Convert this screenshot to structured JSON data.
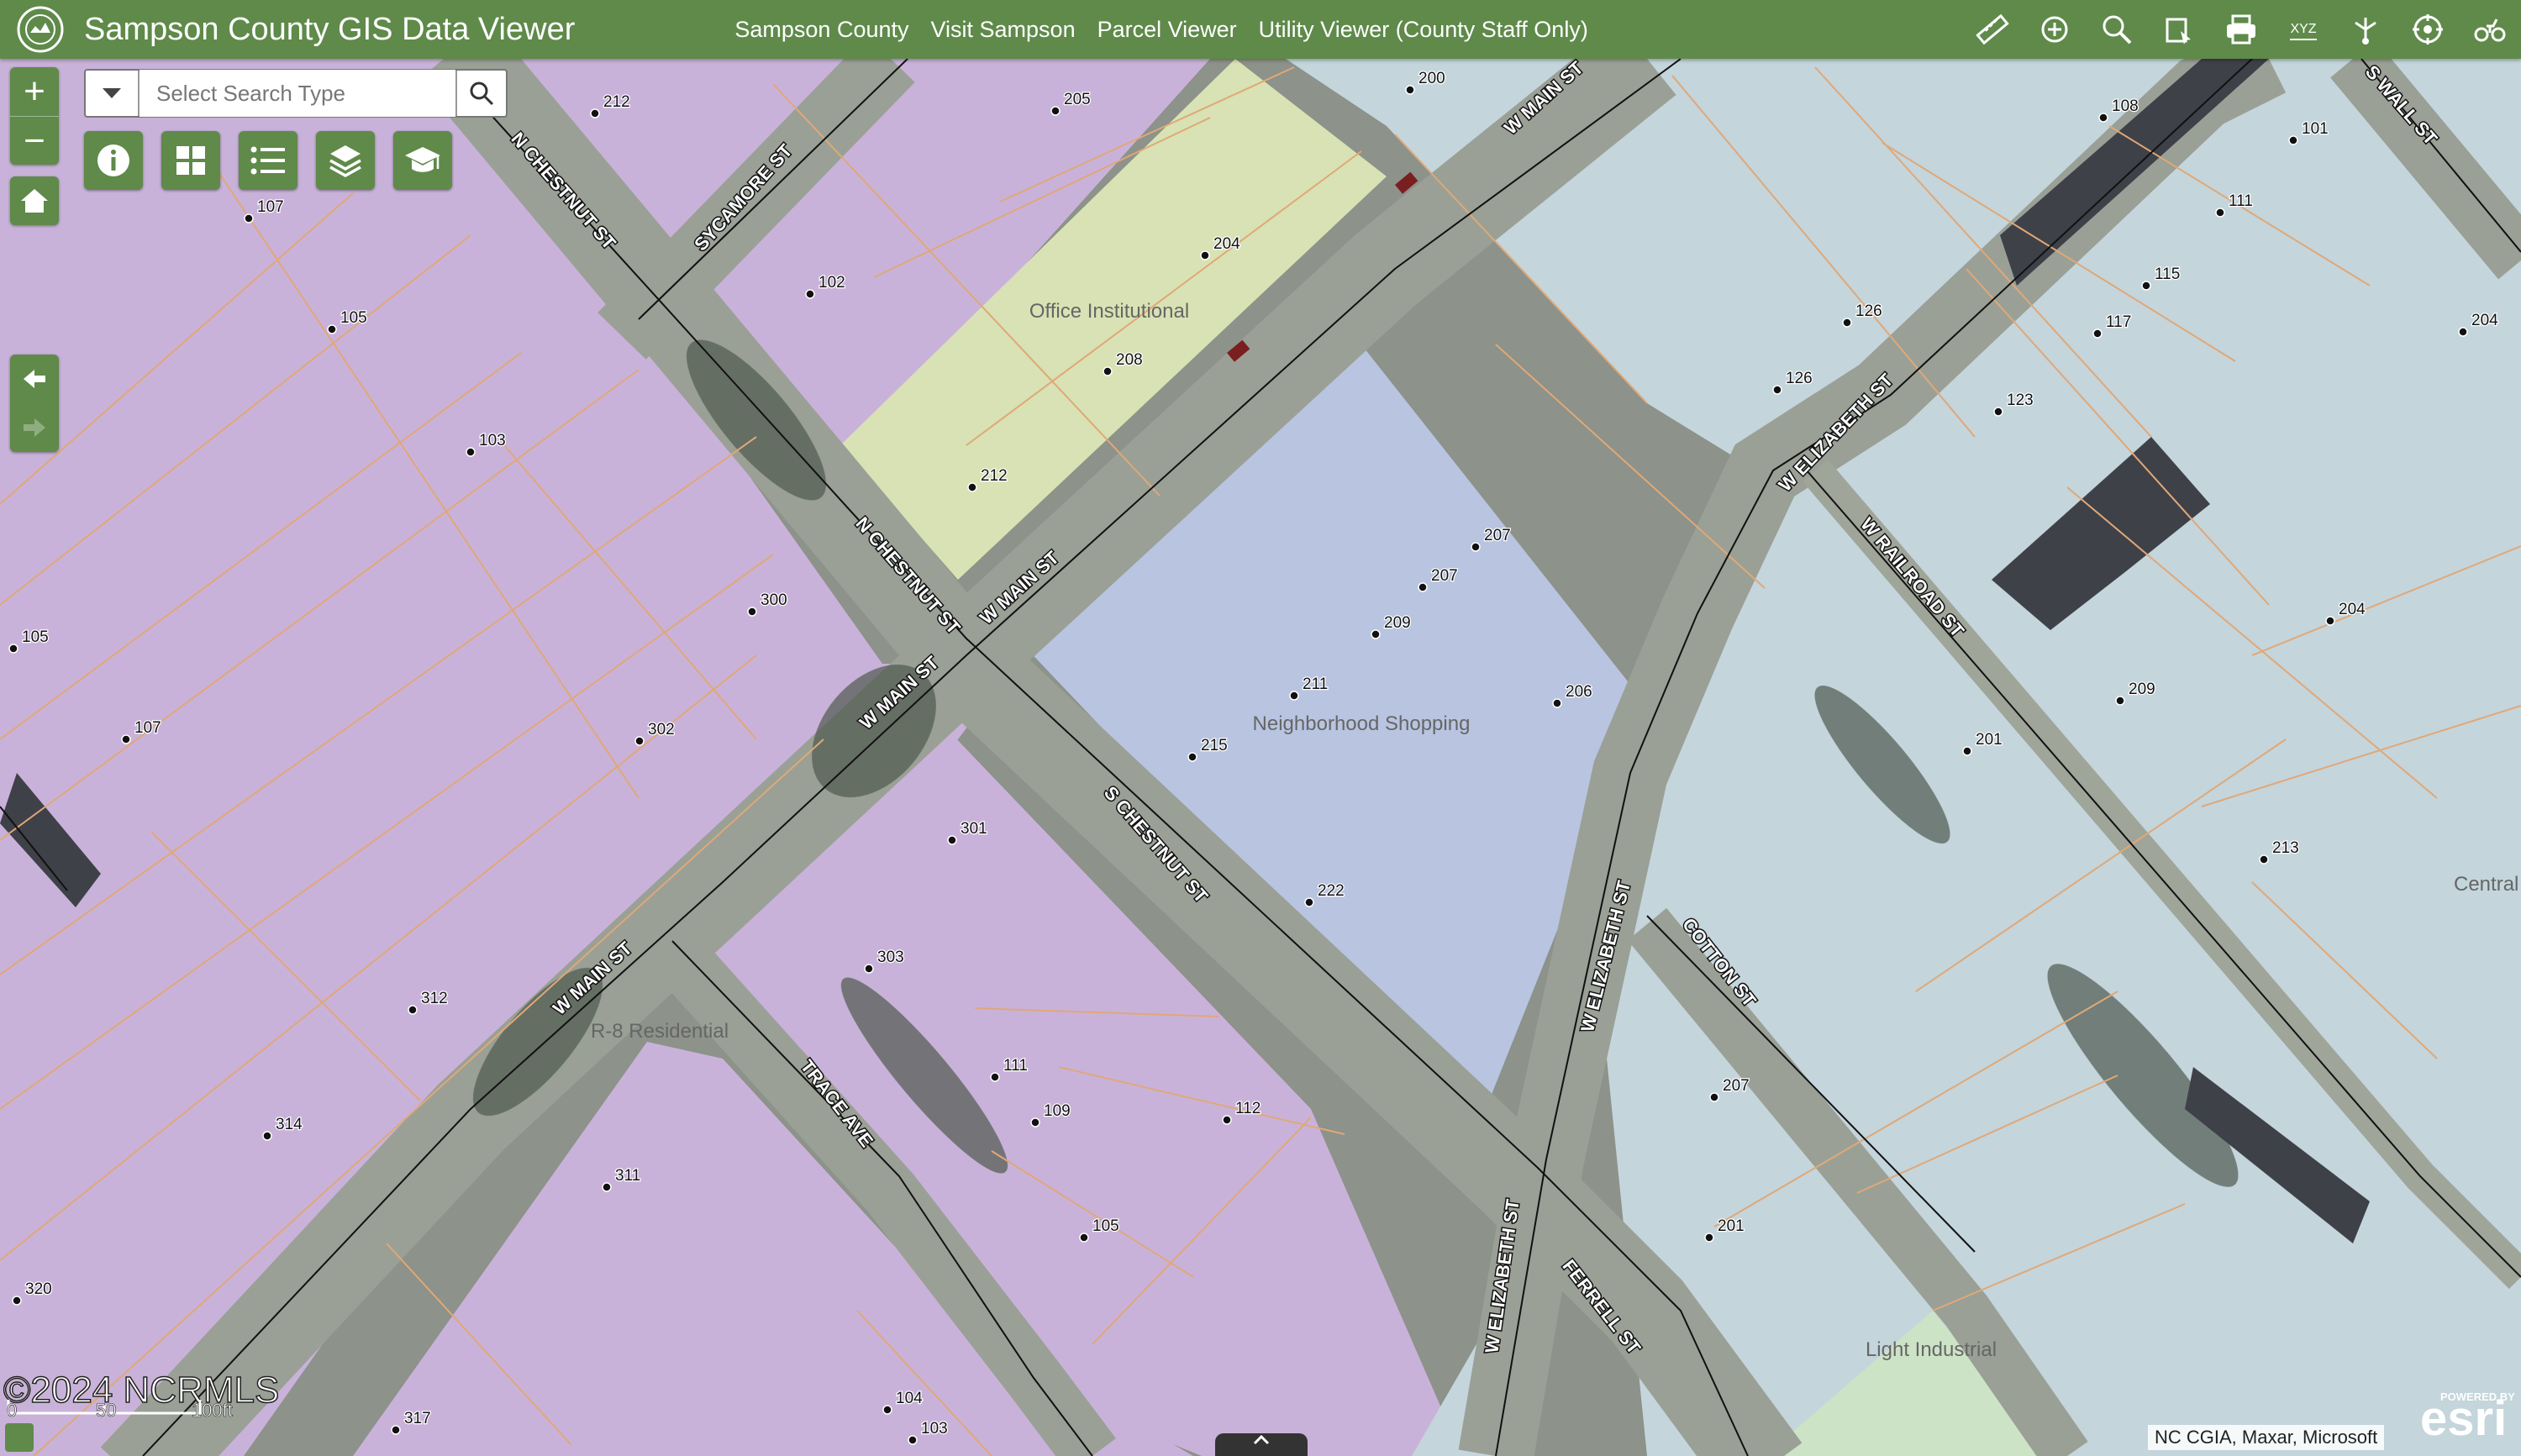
{
  "header": {
    "title": "Sampson County GIS Data Viewer",
    "nav": [
      "Sampson County",
      "Visit Sampson",
      "Parcel Viewer",
      "Utility Viewer (County Staff Only)"
    ],
    "tools": [
      "ruler-icon",
      "parcel-select-icon",
      "search-map-icon",
      "layer-select-icon",
      "print-icon",
      "xyz-coordinates-icon",
      "share-icon",
      "locate-icon",
      "drone-icon"
    ],
    "xyz_label": "XYZ"
  },
  "controls": {
    "zoom_in": "+",
    "zoom_out": "−",
    "search_placeholder": "Select Search Type",
    "widget_icons": [
      "info-icon",
      "basemap-gallery-icon",
      "legend-icon",
      "layers-icon",
      "graduation-cap-icon"
    ]
  },
  "map": {
    "zones": {
      "r8": "R-8 Residential",
      "office": "Office Institutional",
      "shopping": "Neighborhood Shopping",
      "industrial": "Light Industrial",
      "central": "Central"
    },
    "streets": {
      "n_chestnut_1": "N CHESTNUT ST",
      "n_chestnut_2": "N CHESTNUT ST",
      "sycamore": "SYCAMORE ST",
      "w_main_1": "W MAIN ST",
      "w_main_2": "W MAIN ST",
      "w_main_3": "W MAIN ST",
      "w_main_4": "W MAIN ST",
      "s_chestnut": "S CHESTNUT ST",
      "trace": "TRACE AVE",
      "w_elizabeth_1": "W ELIZABETH ST",
      "w_elizabeth_2": "W ELIZABETH ST",
      "w_elizabeth_3": "W ELIZABETH ST",
      "w_railroad": "W RAILROAD ST",
      "cotton": "COTTON ST",
      "ferrell": "FERRELL ST",
      "s_wall": "S WALL ST"
    },
    "addresses": [
      "212",
      "205",
      "107",
      "105",
      "102",
      "204",
      "208",
      "212",
      "103",
      "105",
      "300",
      "107",
      "302",
      "301",
      "303",
      "312",
      "111",
      "109",
      "112",
      "314",
      "311",
      "105",
      "320",
      "104",
      "103",
      "317",
      "200",
      "207",
      "207",
      "209",
      "211",
      "206",
      "215",
      "222",
      "108",
      "101",
      "111",
      "115",
      "117",
      "126",
      "126",
      "123",
      "204",
      "204",
      "209",
      "201",
      "213",
      "207",
      "201"
    ]
  },
  "footer": {
    "attribution": "NC CGIA, Maxar, Microsoft",
    "esri_powered": "POWERED BY",
    "esri": "esri",
    "copyright": "©2024 NCRMLS",
    "scale_0": "0",
    "scale_50": "50",
    "scale_100": "100ft"
  },
  "colors": {
    "header": "#5f8a4a",
    "residential": "#c9b2da",
    "office": "#d8e2b4",
    "shopping": "#b8c4e0",
    "industrial": "#c4d5dc",
    "parcel_line": "#e0a877"
  }
}
